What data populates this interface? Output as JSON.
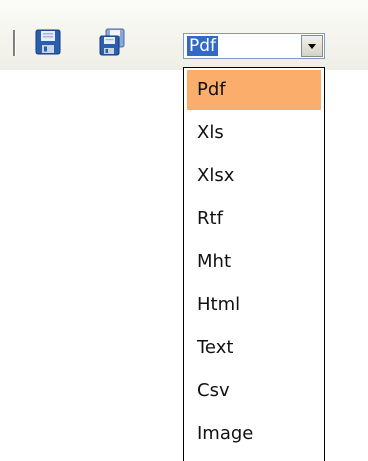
{
  "toolbar": {
    "save_icon": "floppy-disk-icon",
    "save_all_icon": "floppy-disks-icon"
  },
  "format_select": {
    "selected": "Pdf",
    "options": [
      "Pdf",
      "Xls",
      "Xlsx",
      "Rtf",
      "Mht",
      "Html",
      "Text",
      "Csv",
      "Image"
    ],
    "highlight_color": "#fbad6b",
    "selection_color": "#316ac5"
  }
}
